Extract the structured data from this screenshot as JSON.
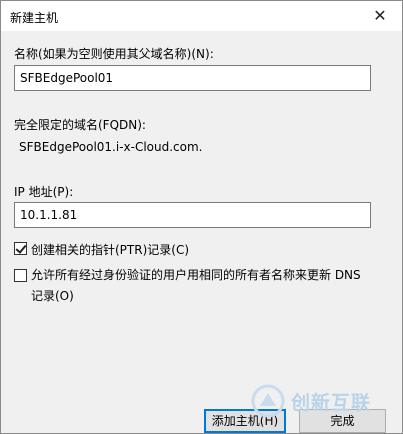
{
  "window": {
    "title": "新建主机",
    "close_glyph": "✕"
  },
  "name_field": {
    "label": "名称(如果为空则使用其父域名称)(N):",
    "value": "SFBEdgePool01"
  },
  "fqdn_field": {
    "label": "完全限定的域名(FQDN):",
    "value": "SFBEdgePool01.i-x-Cloud.com."
  },
  "ip_field": {
    "label": "IP 地址(P):",
    "value": "10.1.1.81"
  },
  "ptr_checkbox": {
    "label": "创建相关的指针(PTR)记录(C)",
    "checked": true
  },
  "dns_checkbox": {
    "label": "允许所有经过身份验证的用户用相同的所有者名称来更新 DNS 记录(O)",
    "checked": false
  },
  "buttons": {
    "add_host": "添加主机(H)",
    "done": "完成"
  },
  "watermark": {
    "text": "创新互联"
  },
  "colors": {
    "accent": "#0078d7",
    "dialog_bg": "#f0f0f0"
  }
}
